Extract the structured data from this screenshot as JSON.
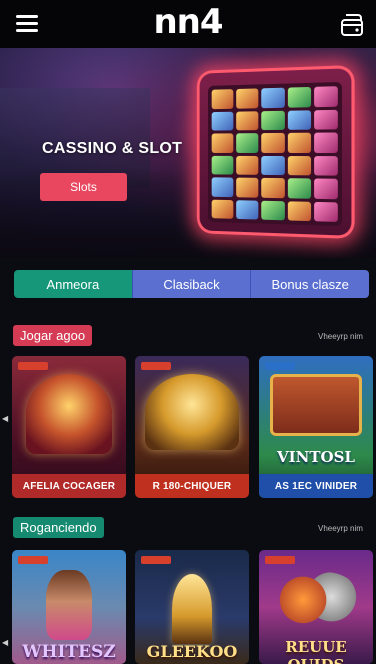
{
  "header": {
    "logo": "nn4",
    "menu_icon": "hamburger-menu-icon",
    "wallet_icon": "wallet-icon"
  },
  "hero": {
    "title": "CASSINO & SLOT",
    "button_label": "Slots"
  },
  "tabs": [
    {
      "label": "Anmeora",
      "active": true
    },
    {
      "label": "Clasiback",
      "active": false
    },
    {
      "label": "Bonus clasze",
      "active": false
    }
  ],
  "sections": [
    {
      "title": "Jogar agoo",
      "see_all": "Vheeyrp nim",
      "games": [
        {
          "label": "AFELIA COCAGER"
        },
        {
          "label": "R 180-CHIQUER"
        },
        {
          "label": "AS 1EC VINIDER",
          "art_text": "VINTOSL"
        }
      ]
    },
    {
      "title": "Roganciendo",
      "see_all": "Vheeyrp nim",
      "games": [
        {
          "art_text": "WHITESZ"
        },
        {
          "art_text": "GLEEKOO"
        },
        {
          "art_text": "REUUE QUIDS"
        }
      ]
    }
  ],
  "colors": {
    "accent_red": "#e8475f",
    "tab_active": "#17977a",
    "tab_inactive": "#5a6fd0"
  }
}
